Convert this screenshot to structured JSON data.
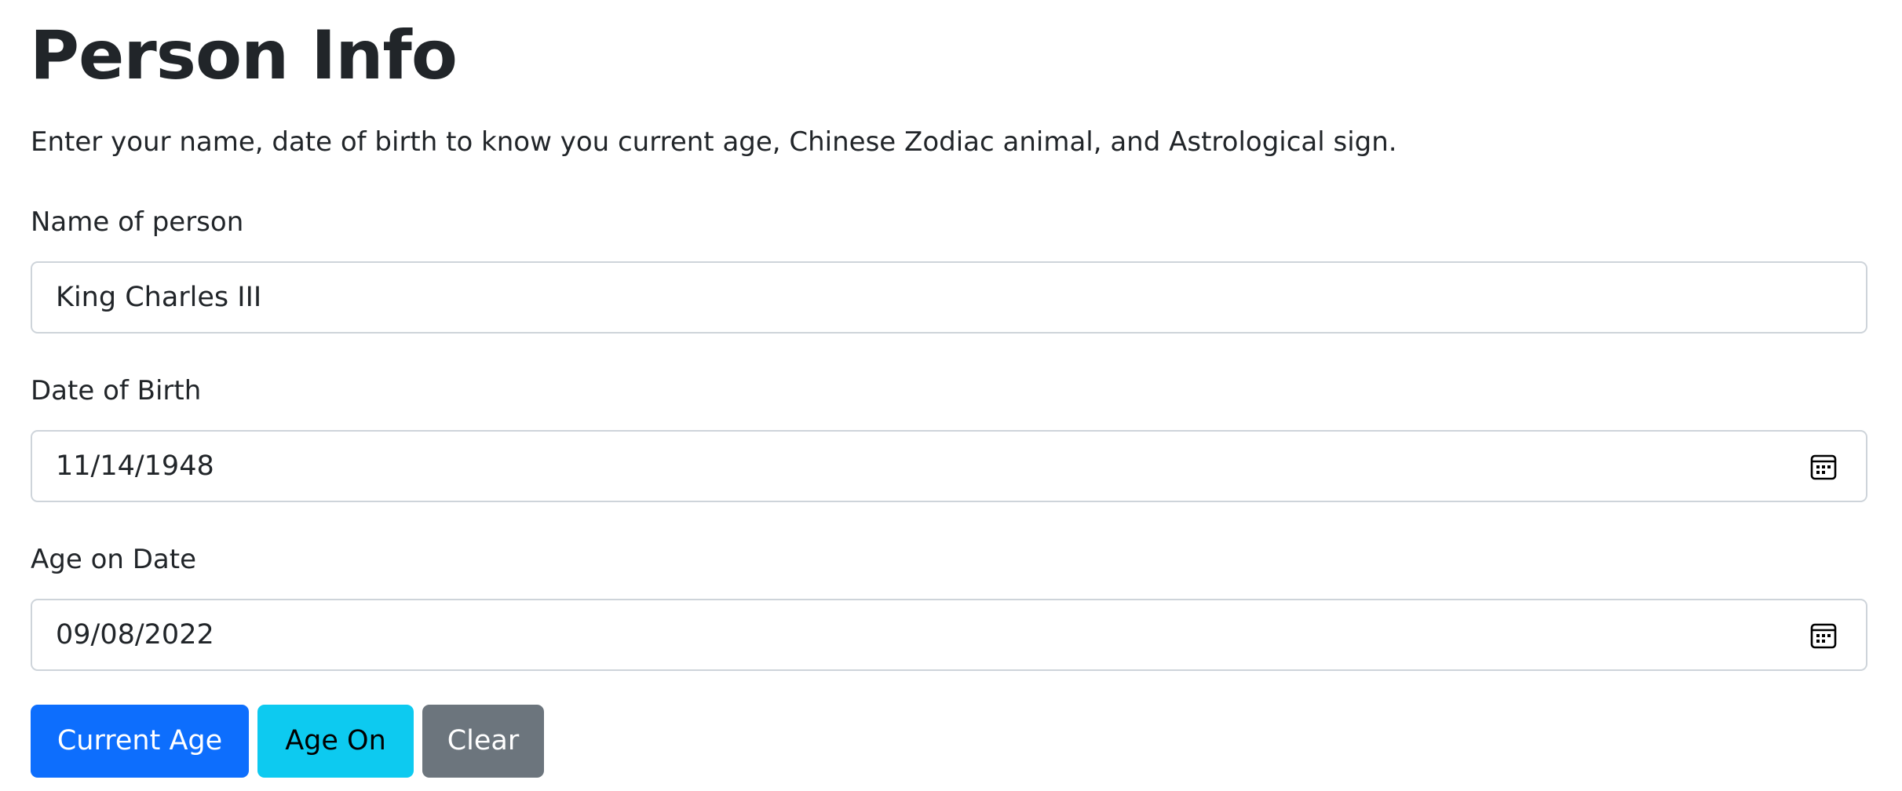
{
  "page": {
    "title": "Person Info",
    "lead": "Enter your name, date of birth to know you current age, Chinese Zodiac animal, and Astrological sign."
  },
  "form": {
    "name": {
      "label": "Name of person",
      "value": "King Charles III"
    },
    "dob": {
      "label": "Date of Birth",
      "value": "11/14/1948",
      "icon": "calendar-icon"
    },
    "age_on": {
      "label": "Age on Date",
      "value": "09/08/2022",
      "icon": "calendar-icon"
    }
  },
  "buttons": {
    "current_age": {
      "label": "Current Age",
      "color": "#0d6efd"
    },
    "age_on": {
      "label": "Age On",
      "color": "#0dcaf0"
    },
    "clear": {
      "label": "Clear",
      "color": "#6c757d"
    }
  }
}
